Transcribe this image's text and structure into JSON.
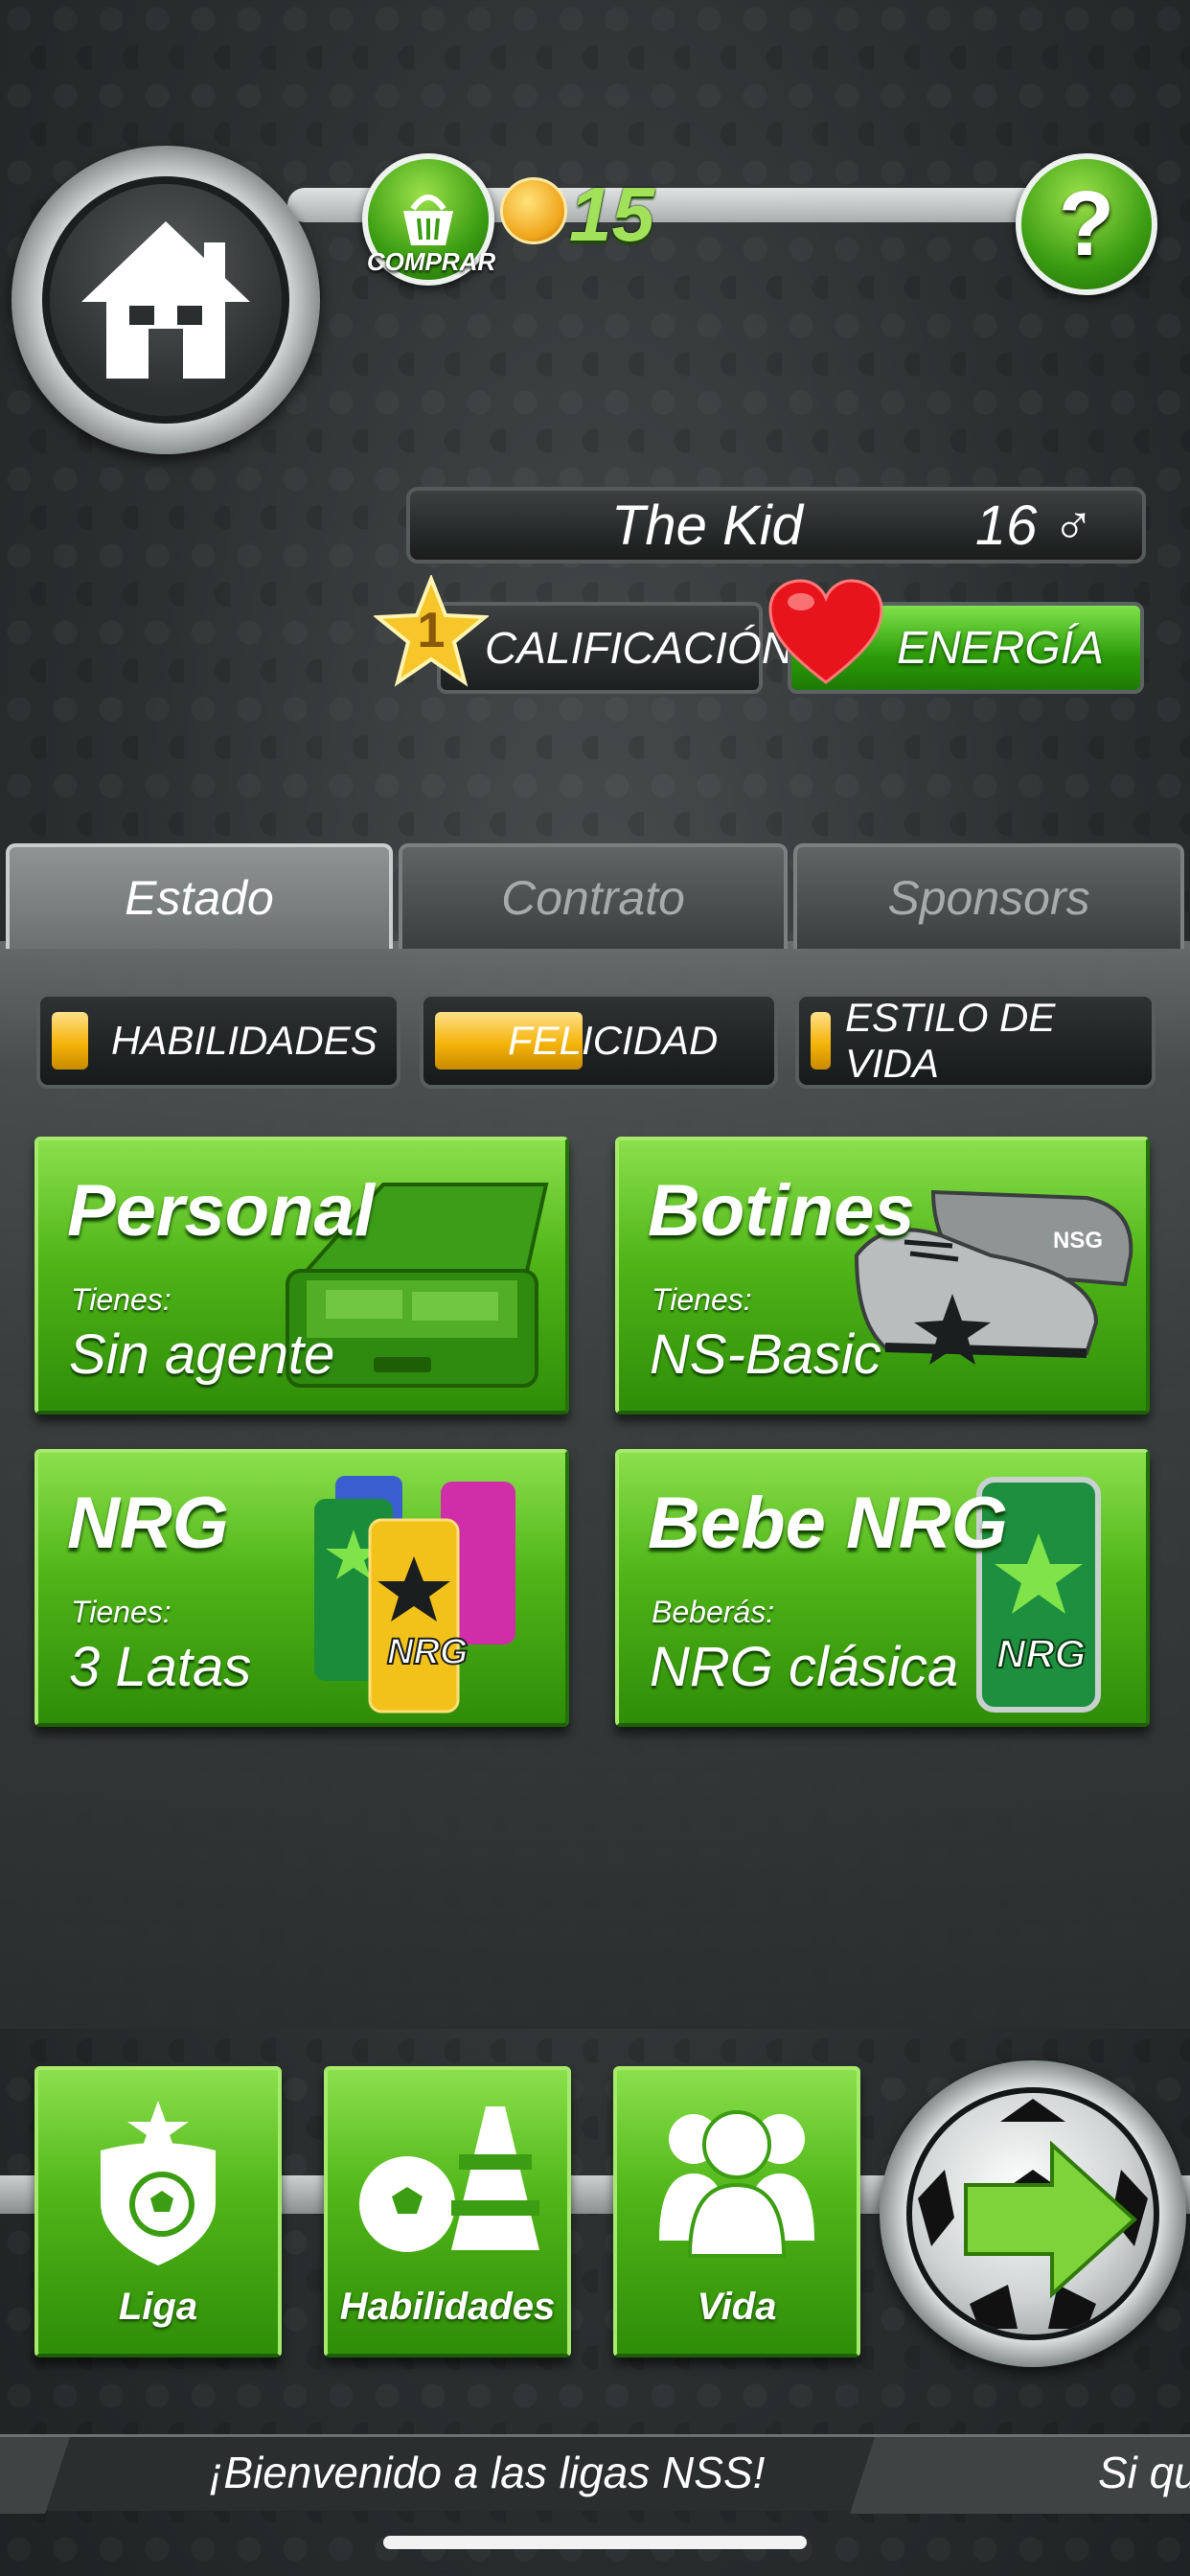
{
  "header": {
    "buy_label": "COMPRAR",
    "coin_count": "15"
  },
  "player": {
    "name": "The Kid",
    "age": "16",
    "gender_symbol": "♂",
    "rating_value": "1",
    "rating_label": "CALIFICACIÓN",
    "energy_label": "ENERGÍA"
  },
  "tabs": [
    {
      "label": "Estado",
      "active": true
    },
    {
      "label": "Contrato",
      "active": false
    },
    {
      "label": "Sponsors",
      "active": false
    }
  ],
  "stats": [
    {
      "label": "HABILIDADES",
      "level": 0.11
    },
    {
      "label": "FELICIDAD",
      "level": 0.45
    },
    {
      "label": "ESTILO DE VIDA",
      "level": 0.06
    }
  ],
  "cards": [
    {
      "title": "Personal",
      "sub": "Tienes:",
      "value": "Sin agente",
      "icon": "briefcase-money-icon"
    },
    {
      "title": "Botines",
      "sub": "Tienes:",
      "value": "NS-Basic",
      "icon": "football-boots-icon",
      "art_text": "NSG"
    },
    {
      "title": "NRG",
      "sub": "Tienes:",
      "value": "3 Latas",
      "icon": "energy-cans-icon",
      "art_text": "NRG"
    },
    {
      "title": "Bebe NRG",
      "sub": "Beberás:",
      "value": "NRG clásica",
      "icon": "energy-can-icon",
      "art_text": "NRG"
    }
  ],
  "nav": [
    {
      "label": "Liga",
      "icon": "league-shield-icon"
    },
    {
      "label": "Habilidades",
      "icon": "ball-cone-icon"
    },
    {
      "label": "Vida",
      "icon": "people-icon"
    }
  ],
  "ticker": {
    "text1": "¡Bienvenido a las ligas NSS!",
    "text2": "Si qu"
  },
  "colors": {
    "green": "#4fb518",
    "gold": "#f5b40a",
    "coin_text": "#a2e15a"
  }
}
